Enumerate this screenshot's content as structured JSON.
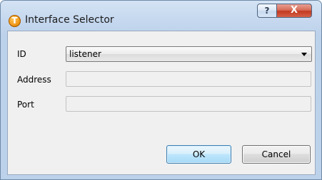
{
  "window": {
    "title": "Interface Selector",
    "app_icon_glyph": "T",
    "help_button": "?",
    "close_button": "X"
  },
  "form": {
    "id": {
      "label": "ID",
      "value": "listener"
    },
    "address": {
      "label": "Address",
      "value": ""
    },
    "port": {
      "label": "Port",
      "value": ""
    }
  },
  "buttons": {
    "ok": "OK",
    "cancel": "Cancel"
  },
  "colors": {
    "titlebar": "#c4d7ee",
    "close_button": "#c2391f",
    "default_button_border": "#3c7fb1"
  }
}
